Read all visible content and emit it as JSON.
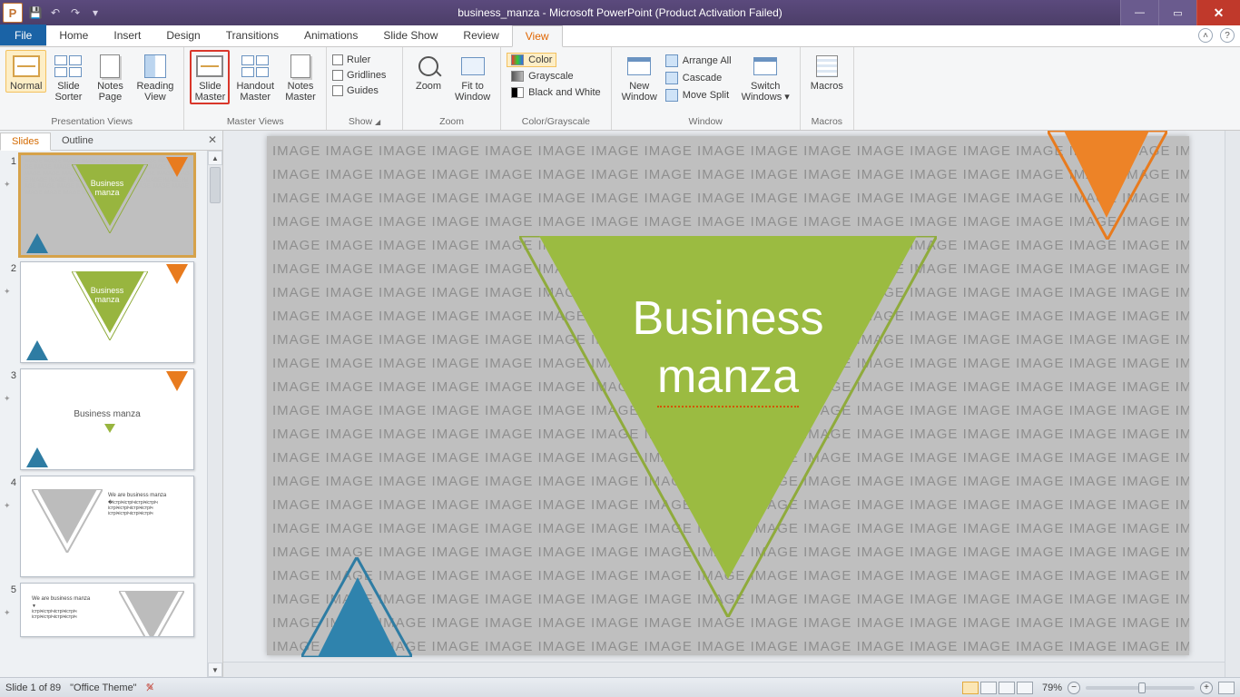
{
  "titlebar": {
    "title": "business_manza - Microsoft PowerPoint (Product Activation Failed)"
  },
  "tabs": {
    "file": "File",
    "home": "Home",
    "insert": "Insert",
    "design": "Design",
    "transitions": "Transitions",
    "animations": "Animations",
    "slideshow": "Slide Show",
    "review": "Review",
    "view": "View"
  },
  "ribbon": {
    "presentation_views": {
      "label": "Presentation Views",
      "normal": "Normal",
      "sorter": "Slide\nSorter",
      "notes": "Notes\nPage",
      "reading": "Reading\nView"
    },
    "master_views": {
      "label": "Master Views",
      "slide": "Slide\nMaster",
      "handout": "Handout\nMaster",
      "notes": "Notes\nMaster"
    },
    "show": {
      "label": "Show",
      "ruler": "Ruler",
      "gridlines": "Gridlines",
      "guides": "Guides"
    },
    "zoom": {
      "label": "Zoom",
      "zoom": "Zoom",
      "fit": "Fit to\nWindow"
    },
    "color": {
      "label": "Color/Grayscale",
      "color": "Color",
      "gray": "Grayscale",
      "bw": "Black and White"
    },
    "window": {
      "label": "Window",
      "neww": "New\nWindow",
      "arrange": "Arrange All",
      "cascade": "Cascade",
      "move": "Move Split",
      "switch": "Switch\nWindows"
    },
    "macros": {
      "label": "Macros",
      "macros": "Macros"
    }
  },
  "panel": {
    "slides": "Slides",
    "outline": "Outline"
  },
  "thumbs": {
    "nums": [
      "1",
      "2",
      "3",
      "4",
      "5"
    ],
    "t1": "Business\nmanza",
    "t2": "Business\nmanza",
    "t3": "Business manza",
    "t4h": "We are business manza",
    "t5h": "We are business manza"
  },
  "slide": {
    "line1": "Business",
    "line2": "manza",
    "imgword": "IMAGE "
  },
  "status": {
    "slide": "Slide 1 of 89",
    "theme": "\"Office Theme\"",
    "zoom": "79%"
  }
}
